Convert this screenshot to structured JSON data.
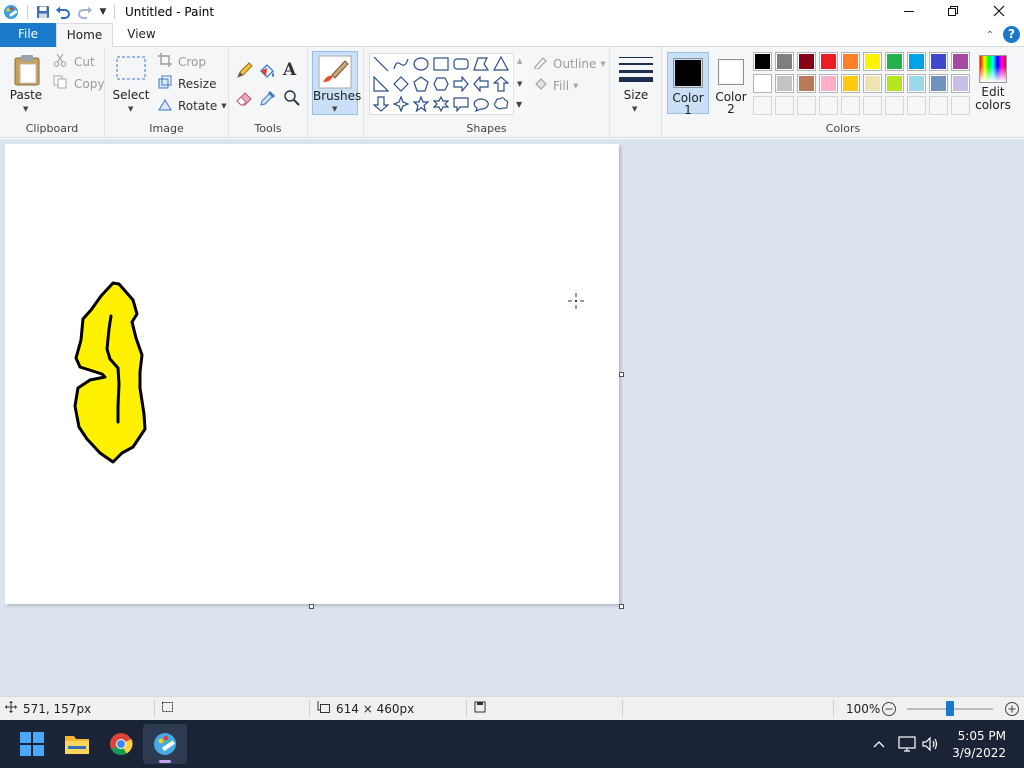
{
  "titlebar": {
    "title": "Untitled - Paint",
    "qat_icons": [
      "paint-app-icon",
      "save-icon",
      "undo-icon",
      "redo-icon",
      "customize-qat-icon"
    ],
    "window_controls": [
      "minimize-icon",
      "maximize-icon",
      "close-icon"
    ]
  },
  "tabs": {
    "file": "File",
    "home": "Home",
    "view": "View"
  },
  "clipboard": {
    "paste": "Paste",
    "cut": "Cut",
    "copy": "Copy",
    "label": "Clipboard"
  },
  "image": {
    "select": "Select",
    "crop": "Crop",
    "resize": "Resize",
    "rotate": "Rotate",
    "label": "Image"
  },
  "tools": {
    "label": "Tools",
    "items": [
      "pencil",
      "fill",
      "text",
      "eraser",
      "color-picker",
      "magnifier"
    ]
  },
  "brushes": {
    "label": "Brushes"
  },
  "shapes": {
    "outline": "Outline",
    "fill": "Fill",
    "label": "Shapes"
  },
  "size": {
    "label": "Size"
  },
  "colors": {
    "color1_line1": "Color",
    "color1_line2": "1",
    "color2_line1": "Color",
    "color2_line2": "2",
    "color1_value": "#000000",
    "color2_value": "#ffffff",
    "palette_row1": [
      "#000000",
      "#7f7f7f",
      "#880015",
      "#ed1c24",
      "#ff7f27",
      "#fff200",
      "#22b14c",
      "#00a2e8",
      "#3f48cc",
      "#a349a4"
    ],
    "palette_row2": [
      "#ffffff",
      "#c3c3c3",
      "#b97a57",
      "#ffaec9",
      "#ffc90e",
      "#efe4b0",
      "#b5e61d",
      "#99d9ea",
      "#7092be",
      "#c8bfe7"
    ],
    "edit_line1": "Edit",
    "edit_line2": "colors",
    "label": "Colors"
  },
  "drawing": {
    "fill_color": "#fff200",
    "stroke_color": "#000000"
  },
  "status": {
    "cursor_pos": "571, 157px",
    "canvas_size": "614 × 460px",
    "zoom": "100%",
    "zoom_slider_fraction": 0.5
  },
  "taskbar": {
    "apps": [
      "windows-start-icon",
      "file-explorer-icon",
      "chrome-icon",
      "paint-taskbar-icon"
    ],
    "time": "5:05 PM",
    "date": "3/9/2022"
  }
}
